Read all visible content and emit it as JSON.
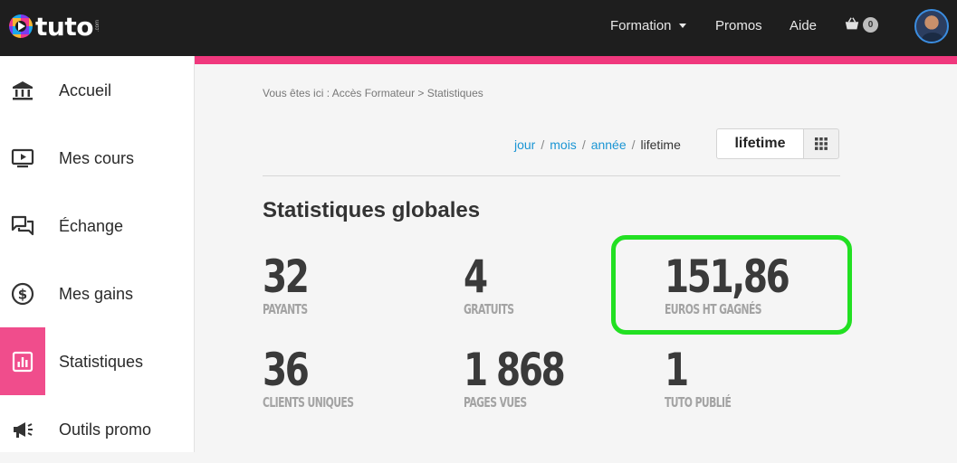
{
  "header": {
    "logo_text": "tuto",
    "logo_tld": ".com",
    "nav": {
      "formation": "Formation",
      "promos": "Promos",
      "aide": "Aide",
      "cart_count": "0"
    }
  },
  "sidebar": {
    "items": [
      {
        "label": "Accueil",
        "icon": "bank-icon"
      },
      {
        "label": "Mes cours",
        "icon": "screen-play-icon"
      },
      {
        "label": "Échange",
        "icon": "chat-icon"
      },
      {
        "label": "Mes gains",
        "icon": "dollar-icon"
      },
      {
        "label": "Statistiques",
        "icon": "bar-chart-icon",
        "active": true
      },
      {
        "label": "Outils promo",
        "icon": "megaphone-icon"
      }
    ]
  },
  "main": {
    "breadcrumb": "Vous êtes ici : Accès Formateur  >  Statistiques",
    "periods": {
      "jour": "jour",
      "mois": "mois",
      "annee": "année",
      "lifetime": "lifetime",
      "sep": "/"
    },
    "period_button": "lifetime",
    "title": "Statistiques globales",
    "stats": [
      {
        "value": "32",
        "caption": "PAYANTS"
      },
      {
        "value": "4",
        "caption": "GRATUITS"
      },
      {
        "value": "151,86",
        "caption": "EUROS HT GAGNÉS"
      },
      {
        "value": "36",
        "caption": "CLIENTS UNIQUES"
      },
      {
        "value": "1 868",
        "caption": "PAGES VUES"
      },
      {
        "value": "1",
        "caption": "TUTO PUBLIÉ"
      }
    ]
  },
  "colors": {
    "topbar": "#1e1e1e",
    "accent_pink": "#f0387d",
    "link_blue": "#1a95d4",
    "highlight_green": "#22e022"
  }
}
